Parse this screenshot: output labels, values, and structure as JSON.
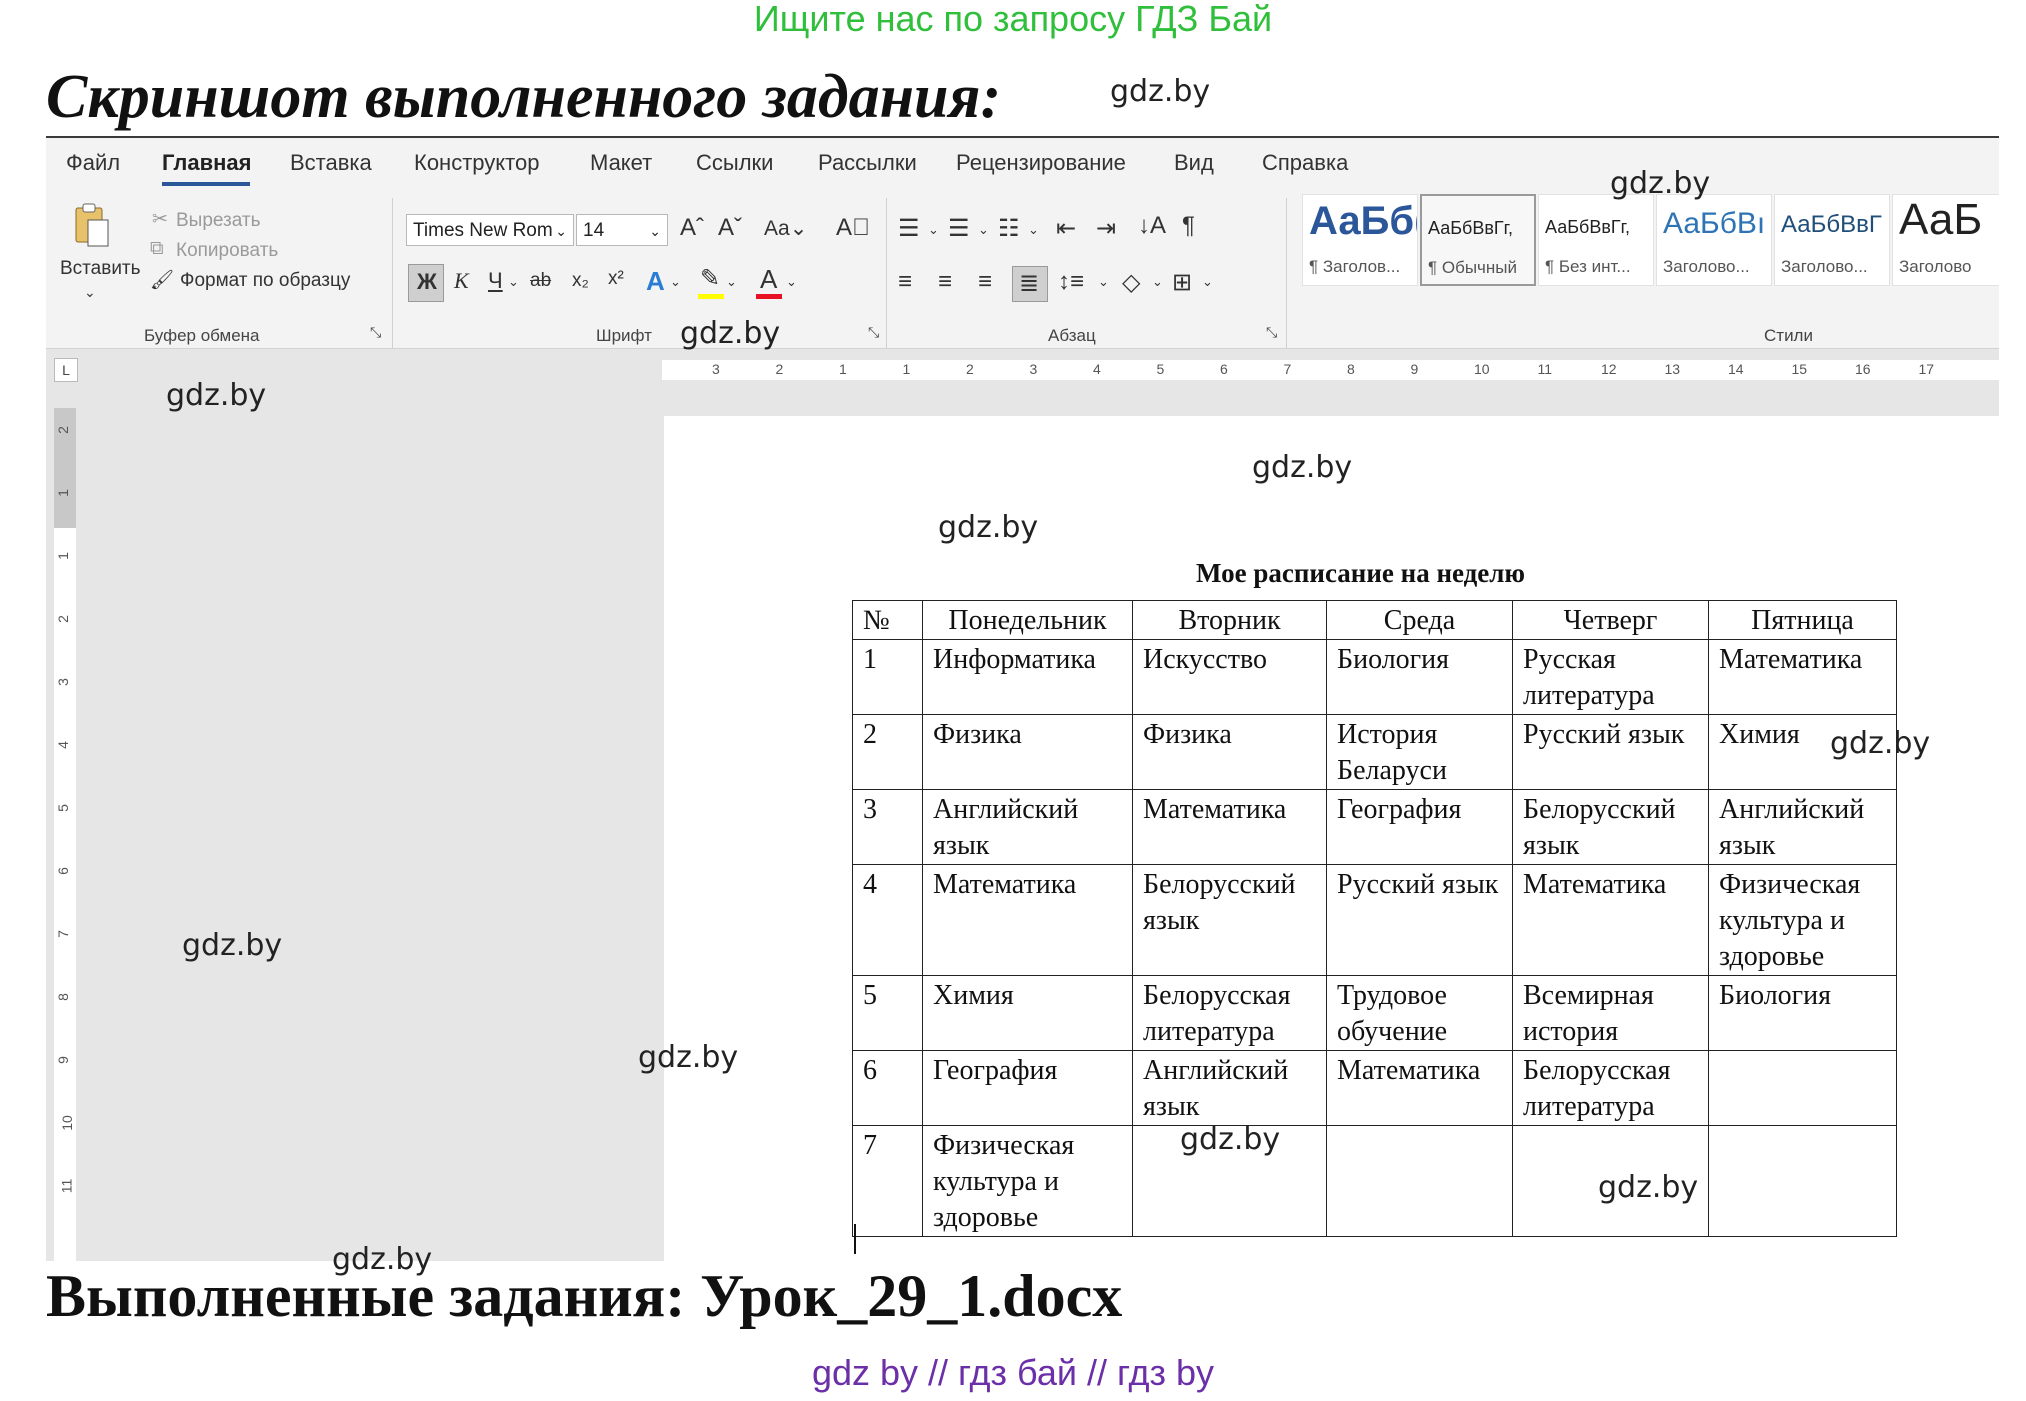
{
  "banner": "Ищите нас по запросу ГДЗ Бай",
  "heading_top": "Скриншот выполненного задания:",
  "heading_bottom": "Выполненные задания: Урок_29_1.docx",
  "footer": "gdz by  //  гдз бай  //  гдз by",
  "watermark": "gdz.by",
  "colors": {
    "banner": "#2fbf3a",
    "footer": "#6b2fa8",
    "accent": "#2b579a"
  },
  "word": {
    "menu": [
      "Файл",
      "Главная",
      "Вставка",
      "Конструктор",
      "Макет",
      "Ссылки",
      "Рассылки",
      "Рецензирование",
      "Вид",
      "Справка"
    ],
    "active_tab": "Главная",
    "clipboard": {
      "paste": "Вставить",
      "cut": "Вырезать",
      "copy": "Копировать",
      "format_painter": "Формат по образцу",
      "label": "Буфер обмена"
    },
    "font": {
      "name": "Times New Rom",
      "size": "14",
      "bold": "Ж",
      "italic": "К",
      "underline": "Ч",
      "strike": "ab",
      "change_case": "Aa",
      "label": "Шрифт"
    },
    "paragraph": {
      "label": "Абзац"
    },
    "styles": {
      "label": "Стили",
      "items": [
        {
          "sample": "АаБб(",
          "name": "¶ Заголов..."
        },
        {
          "sample": "АаБбВвГг,",
          "name": "¶ Обычный"
        },
        {
          "sample": "АаБбВвГг,",
          "name": "¶ Без инт..."
        },
        {
          "sample": "АаБбВı",
          "name": "Заголово..."
        },
        {
          "sample": "АаБбВвГ",
          "name": "Заголово..."
        },
        {
          "sample": "АаБ",
          "name": "Заголово"
        }
      ]
    },
    "ruler_h": [
      "3",
      "2",
      "1",
      "1",
      "2",
      "3",
      "4",
      "5",
      "6",
      "7",
      "8",
      "9",
      "10",
      "11",
      "12",
      "13",
      "14",
      "15",
      "16",
      "17"
    ],
    "ruler_v": [
      "2",
      "1",
      "1",
      "2",
      "3",
      "4",
      "5",
      "6",
      "7",
      "8",
      "9",
      "10",
      "11"
    ]
  },
  "document": {
    "title": "Мое расписание на неделю",
    "headers": [
      "№",
      "Понедельник",
      "Вторник",
      "Среда",
      "Четверг",
      "Пятница"
    ],
    "rows": [
      [
        "1",
        "Информатика",
        "Искусство",
        "Биология",
        "Русская литература",
        "Математика"
      ],
      [
        "2",
        "Физика",
        "Физика",
        "История Беларуси",
        "Русский язык",
        "Химия"
      ],
      [
        "3",
        "Английский язык",
        "Математика",
        "География",
        "Белорусский язык",
        "Английский язык"
      ],
      [
        "4",
        "Математика",
        "Белорусский язык",
        "Русский язык",
        "Математика",
        "Физическая культура и здоровье"
      ],
      [
        "5",
        "Химия",
        "Белорусская литература",
        "Трудовое обучение",
        "Всемирная история",
        "Биология"
      ],
      [
        "6",
        "География",
        "Английский язык",
        "Математика",
        "Белорусская литература",
        ""
      ],
      [
        "7",
        "Физическая культура и здоровье",
        "",
        "",
        "",
        ""
      ]
    ]
  }
}
